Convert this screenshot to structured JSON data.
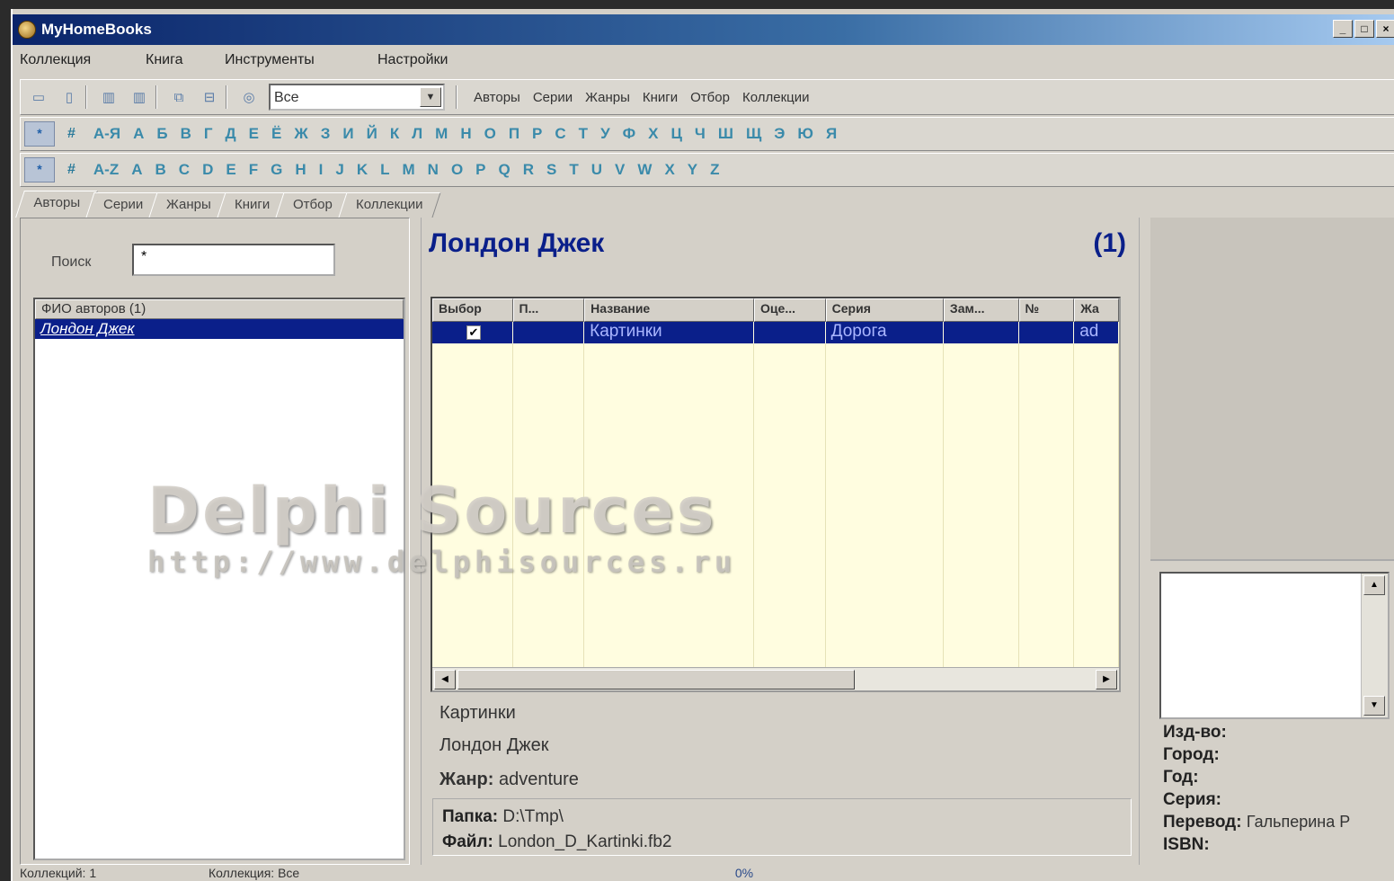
{
  "window": {
    "title": "MyHomeBooks",
    "controls": [
      "_",
      "□",
      "×"
    ]
  },
  "menu": [
    "Коллекция",
    "Книга",
    "Инструменты",
    "Настройки"
  ],
  "toolbar": {
    "combo_value": "Все",
    "links": [
      "Авторы",
      "Серии",
      "Жанры",
      "Книги",
      "Отбор",
      "Коллекции"
    ]
  },
  "alpha_ru": {
    "star": "*",
    "hash": "#",
    "letters": [
      "А-Я",
      "А",
      "Б",
      "В",
      "Г",
      "Д",
      "Е",
      "Ё",
      "Ж",
      "З",
      "И",
      "Й",
      "К",
      "Л",
      "М",
      "Н",
      "О",
      "П",
      "Р",
      "С",
      "Т",
      "У",
      "Ф",
      "Х",
      "Ц",
      "Ч",
      "Ш",
      "Щ",
      "Э",
      "Ю",
      "Я"
    ]
  },
  "alpha_en": {
    "star": "*",
    "hash": "#",
    "letters": [
      "A-Z",
      "A",
      "B",
      "C",
      "D",
      "E",
      "F",
      "G",
      "H",
      "I",
      "J",
      "K",
      "L",
      "M",
      "N",
      "O",
      "P",
      "Q",
      "R",
      "S",
      "T",
      "U",
      "V",
      "W",
      "X",
      "Y",
      "Z"
    ]
  },
  "tabs": [
    "Авторы",
    "Серии",
    "Жанры",
    "Книги",
    "Отбор",
    "Коллекции"
  ],
  "search": {
    "label": "Поиск",
    "value": "*"
  },
  "authors": {
    "header": "ФИО авторов (1)",
    "selected": "Лондон Джек"
  },
  "main": {
    "heading": "Лондон Джек",
    "count": "(1)"
  },
  "grid": {
    "columns": [
      "Выбор",
      "П...",
      "Название",
      "Оце...",
      "Серия",
      "Зам...",
      "№",
      "Жа"
    ],
    "row": {
      "checked": "✔",
      "title": "Картинки",
      "series": "Дорога",
      "genre": "ad"
    }
  },
  "book": {
    "title": "Картинки",
    "author": "Лондон Джек",
    "genre_label": "Жанр:",
    "genre_value": "adventure",
    "folder_label": "Папка:",
    "folder_value": "D:\\Tmp\\",
    "file_label": "Файл:",
    "file_value": "London_D_Kartinki.fb2"
  },
  "details": {
    "publisher_label": "Изд-во:",
    "city_label": "Город:",
    "year_label": "Год:",
    "series_label": "Серия:",
    "translation_label": "Перевод:",
    "translation_value": "Гальперина Р",
    "isbn_label": "ISBN:"
  },
  "status": {
    "collections": "Коллекций: 1",
    "collection": "Коллекция: Все",
    "progress": "0%"
  },
  "watermark": {
    "line1": "Delphi Sources",
    "line2": "http://www.delphisources.ru"
  }
}
